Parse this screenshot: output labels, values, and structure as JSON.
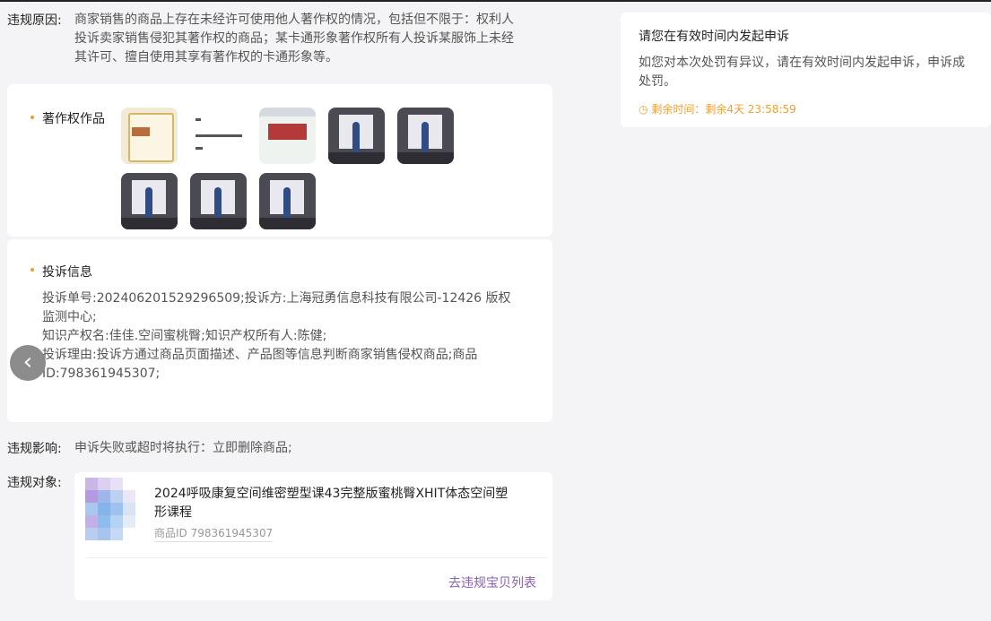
{
  "violation": {
    "reason_label": "违规原因:",
    "reason_lines": [
      "商家销售的商品上存在未经许可使用他人著作权的情况，包括但不限于：权利人",
      "投诉卖家销售侵犯其著作权的商品；某卡通形象著作权所有人投诉某服饰上未经",
      "其许可、擅自使用其享有著作权的卡通形象等。"
    ],
    "impact_label": "违规影响:",
    "impact_text": "申诉失败或超时将执行：立即删除商品;",
    "object_label": "违规对象:"
  },
  "works": {
    "title": "著作权作品",
    "thumbnails": [
      "certificate",
      "text-document",
      "screenshot",
      "photo",
      "photo",
      "photo",
      "photo",
      "photo"
    ]
  },
  "complaint": {
    "title": "投诉信息",
    "lines": [
      "投诉单号:202406201529296509;投诉方:上海冠勇信息科技有限公司-12426 版权",
      "监测中心;",
      "知识产权名:佳佳.空间蜜桃臀;知识产权所有人:陈健;",
      "投诉理由:投诉方通过商品页面描述、产品图等信息判断商家销售侵权商品;商品",
      "ID:798361945307;"
    ]
  },
  "product": {
    "name_lines": [
      "2024呼吸康复空间维密塑型课43完整版蜜桃臀XHIT体态空间塑",
      "形课程"
    ],
    "id_text": "商品ID 798361945307",
    "link_label": "去违规宝贝列表"
  },
  "appeal": {
    "title": "请您在有效时间内发起申诉",
    "body_lines": [
      "如您对本次处罚有异议，请在有效时间内发起申诉，申诉成",
      "处罚。"
    ],
    "remaining": "剩余时间：剩余4天 23:58:59"
  },
  "navigation": {
    "prev_icon": "chevron-left-icon"
  },
  "colors": {
    "accent_orange": "#f0a030",
    "link_purple": "#8a5fb0",
    "nav_gray": "#8c8c8c"
  }
}
